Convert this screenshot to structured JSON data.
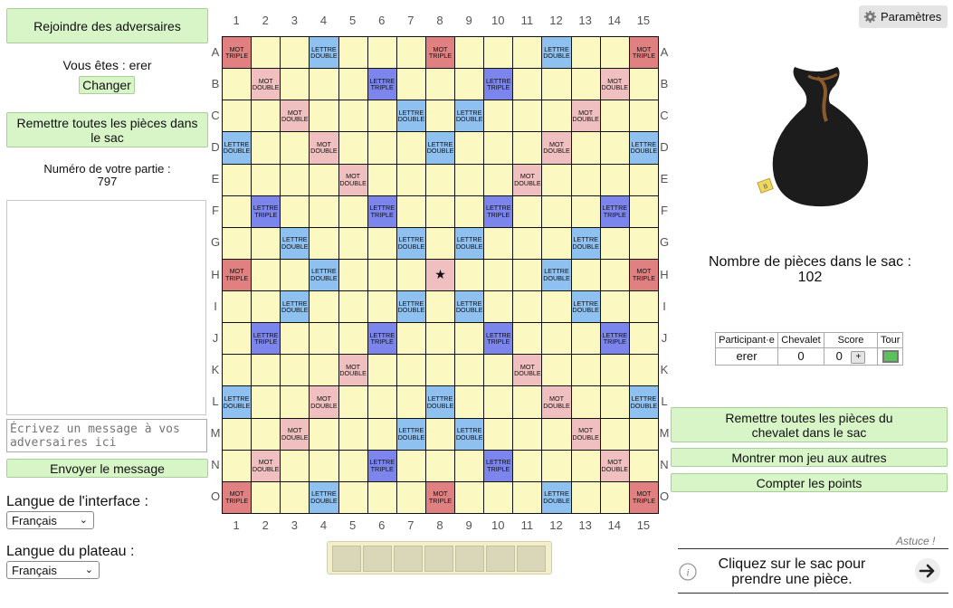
{
  "left": {
    "join_btn": "Rejoindre des adversaires",
    "you_are": "Vous êtes : erer",
    "change_btn": "Changer",
    "return_all_btn": "Remettre toutes les pièces dans le sac",
    "game_number_label": "Numéro de votre partie :",
    "game_number": "797",
    "chat_placeholder": "Écrivez un message à vos adversaires ici",
    "send_btn": "Envoyer le message",
    "ui_lang_label": "Langue de l'interface :",
    "ui_lang_value": "Français",
    "board_lang_label": "Langue du plateau :",
    "board_lang_value": "Français"
  },
  "board": {
    "columns": [
      "1",
      "2",
      "3",
      "4",
      "5",
      "6",
      "7",
      "8",
      "9",
      "10",
      "11",
      "12",
      "13",
      "14",
      "15"
    ],
    "rows": [
      "A",
      "B",
      "C",
      "D",
      "E",
      "F",
      "G",
      "H",
      "I",
      "J",
      "K",
      "L",
      "M",
      "N",
      "O"
    ],
    "labels": {
      "mt": [
        "MOT",
        "TRIPLE"
      ],
      "md": [
        "MOT",
        "DOUBLE"
      ],
      "lt": [
        "LETTRE",
        "TRIPLE"
      ],
      "ld": [
        "LETTRE",
        "DOUBLE"
      ],
      "star": "★"
    },
    "layout": [
      "T..d...T...d..T",
      ".D...t...t...D.",
      "..D...d.d...D..",
      "d..D...d...D..d",
      "....D.....D....",
      ".t...t...t...t.",
      "..d...d.d...d..",
      "T..d...S...d..T",
      "..d...d.d...d..",
      ".t...t...t...t.",
      "....D.....D....",
      "d..D...d...D..d",
      "..D...d.d...D..",
      ".D...t...t...D.",
      "T..d...T...d..T"
    ],
    "rack_slots": 7
  },
  "right": {
    "settings_btn": "Paramètres",
    "settings_icon": "gear-icon",
    "bag_count_label": "Nombre de pièces dans le sac :",
    "bag_count": "102",
    "table": {
      "headers": [
        "Participant·e",
        "Chevalet",
        "Score",
        "Tour"
      ],
      "rows": [
        {
          "name": "erer",
          "rack": "0",
          "score": "0",
          "plus": "+"
        }
      ]
    },
    "return_rack_btn": "Remettre toutes les pièces du chevalet dans le sac",
    "show_game_btn": "Montrer mon jeu aux autres",
    "count_points_btn": "Compter les points",
    "hint_label": "Astuce !",
    "hint_text": "Cliquez sur le sac pour prendre une pièce.",
    "bag_tile_letter": "B"
  }
}
